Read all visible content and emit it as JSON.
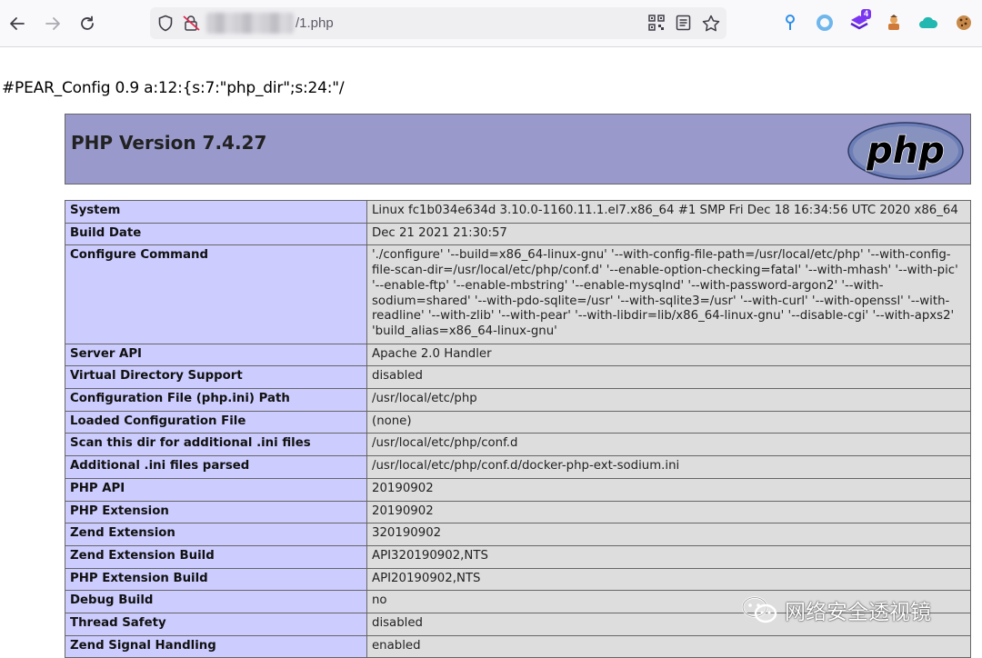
{
  "browser": {
    "url_suffix": "/1.php",
    "icons": [
      "back-arrow-icon",
      "forward-arrow-icon",
      "reload-icon",
      "shield-icon",
      "insecure-lock-icon",
      "qr-code-icon",
      "reader-view-icon",
      "bookmark-star-icon"
    ],
    "extensions": [
      {
        "name": "location-pin-icon"
      },
      {
        "name": "circle-ring-icon"
      },
      {
        "name": "purple-stack-icon",
        "badge": "4"
      },
      {
        "name": "character-avatar-icon"
      },
      {
        "name": "cloud-icon"
      },
      {
        "name": "cookie-icon"
      }
    ]
  },
  "page": {
    "pear_line": "#PEAR_Config 0.9 a:12:{s:7:\"php_dir\";s:24:\"/",
    "php_version_title": "PHP Version 7.4.27",
    "logo_text": "php",
    "colors": {
      "header": "#9999cc",
      "label_cell": "#ccccff",
      "value_cell": "#dddddd"
    },
    "rows": [
      {
        "label": "System",
        "value": "Linux fc1b034e634d 3.10.0-1160.11.1.el7.x86_64 #1 SMP Fri Dec 18 16:34:56 UTC 2020 x86_64"
      },
      {
        "label": "Build Date",
        "value": "Dec 21 2021 21:30:57"
      },
      {
        "label": "Configure Command",
        "value": "'./configure' '--build=x86_64-linux-gnu' '--with-config-file-path=/usr/local/etc/php' '--with-config-file-scan-dir=/usr/local/etc/php/conf.d' '--enable-option-checking=fatal' '--with-mhash' '--with-pic' '--enable-ftp' '--enable-mbstring' '--enable-mysqlnd' '--with-password-argon2' '--with-sodium=shared' '--with-pdo-sqlite=/usr' '--with-sqlite3=/usr' '--with-curl' '--with-openssl' '--with-readline' '--with-zlib' '--with-pear' '--with-libdir=lib/x86_64-linux-gnu' '--disable-cgi' '--with-apxs2' 'build_alias=x86_64-linux-gnu'"
      },
      {
        "label": "Server API",
        "value": "Apache 2.0 Handler"
      },
      {
        "label": "Virtual Directory Support",
        "value": "disabled"
      },
      {
        "label": "Configuration File (php.ini) Path",
        "value": "/usr/local/etc/php"
      },
      {
        "label": "Loaded Configuration File",
        "value": "(none)"
      },
      {
        "label": "Scan this dir for additional .ini files",
        "value": "/usr/local/etc/php/conf.d"
      },
      {
        "label": "Additional .ini files parsed",
        "value": "/usr/local/etc/php/conf.d/docker-php-ext-sodium.ini"
      },
      {
        "label": "PHP API",
        "value": "20190902"
      },
      {
        "label": "PHP Extension",
        "value": "20190902"
      },
      {
        "label": "Zend Extension",
        "value": "320190902"
      },
      {
        "label": "Zend Extension Build",
        "value": "API320190902,NTS"
      },
      {
        "label": "PHP Extension Build",
        "value": "API20190902,NTS"
      },
      {
        "label": "Debug Build",
        "value": "no"
      },
      {
        "label": "Thread Safety",
        "value": "disabled"
      },
      {
        "label": "Zend Signal Handling",
        "value": "enabled"
      }
    ]
  },
  "watermark": {
    "text": "网络安全透视镜",
    "icon": "wechat-icon"
  }
}
